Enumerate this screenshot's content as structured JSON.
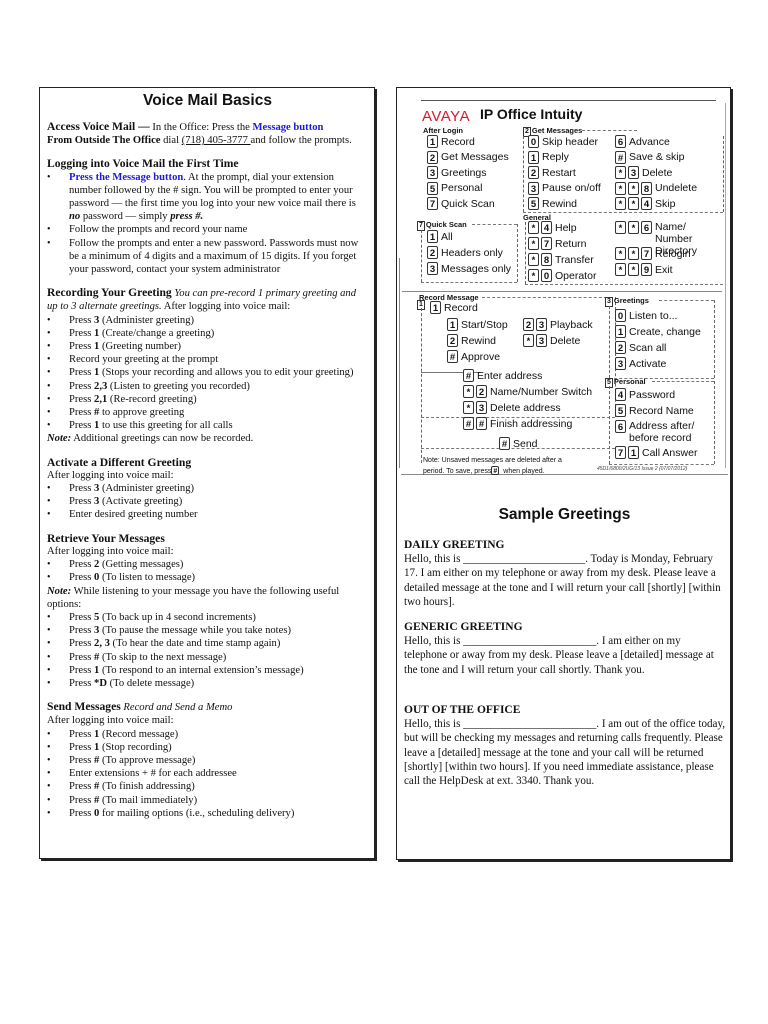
{
  "left": {
    "title": "Voice Mail Basics",
    "access": {
      "heading": "Access Voice Mail —",
      "text1": " In  the Office: Press the ",
      "link": "Message button",
      "outside_label": "From Outside The Office",
      "text2": " dial ",
      "phone": "(718) 405-3777 ",
      "text3": "and follow the prompts."
    },
    "first_time": {
      "heading": "Logging into Voice Mail the First Time",
      "item1_link": "Press the Message button",
      "item1_text": ".  At the prompt, dial your extension number followed by the # sign.  You will be prompted to enter your password — the first time you log into your new voice mail there is ",
      "item1_no": "no",
      "item1_mid": " password — simply ",
      "item1_press": "press #.",
      "items": [
        "Follow the prompts and record your name",
        "Follow the prompts and enter a new password.  Passwords must now be a minimum of 4 digits and a maximum of 15 digits.  If you forget your password, contact your system administrator"
      ]
    },
    "recording": {
      "heading": "Recording Your Greeting",
      "subtitle": " You can pre-record 1 primary greeting and up to 3 alternate greetings.",
      "intro": "  After logging into voice mail:",
      "items": [
        {
          "pre": "Press ",
          "key": "3",
          "post": " (Administer greeting)"
        },
        {
          "pre": "Press ",
          "key": "1",
          "post": " (Create/change a greeting)"
        },
        {
          "pre": "Press ",
          "key": "1",
          "post": " (Greeting number)"
        },
        {
          "pre": "Record your greeting at the prompt",
          "key": "",
          "post": ""
        },
        {
          "pre": "Press ",
          "key": "1",
          "post": " (Stops your recording and allows you to edit your greeting)"
        },
        {
          "pre": "Press ",
          "key": "2,3",
          "post": " (Listen to greeting you recorded)"
        },
        {
          "pre": "Press ",
          "key": "2,1",
          "post": " (Re-record greeting)"
        },
        {
          "pre": "Press ",
          "key": "#",
          "post": " to approve greeting"
        },
        {
          "pre": "Press ",
          "key": "1",
          "post": " to use this greeting for all calls"
        }
      ],
      "note_label": "Note:",
      "note_text": "  Additional greetings can now be recorded."
    },
    "activate": {
      "heading": "Activate a Different Greeting",
      "intro": "After logging into voice mail:",
      "items": [
        {
          "pre": "Press ",
          "key": "3",
          "post": " (Administer greeting)"
        },
        {
          "pre": "Press ",
          "key": "3",
          "post": " (Activate greeting)"
        },
        {
          "pre": "Enter desired greeting number",
          "key": "",
          "post": ""
        }
      ]
    },
    "retrieve": {
      "heading": "Retrieve Your Messages",
      "intro": "After logging into voice mail:",
      "items": [
        {
          "pre": "Press ",
          "key": "2",
          "post": " (Getting messages)"
        },
        {
          "pre": "Press ",
          "key": "0",
          "post": " (To listen to message)"
        }
      ],
      "note_label": "Note:",
      "note_text": "  While listening to your message you have the following useful options:",
      "options": [
        {
          "pre": "Press ",
          "key": "5",
          "post": " (To back up in 4 second increments)"
        },
        {
          "pre": "Press ",
          "key": "3",
          "post": " (To pause the message while you take notes)"
        },
        {
          "pre": "Press ",
          "key": "2, 3",
          "post": " (To hear the date and time stamp again)"
        },
        {
          "pre": "Press ",
          "key": "#",
          "post": " (To skip to the next message)"
        },
        {
          "pre": "Press ",
          "key": "1",
          "post": " (To respond to an internal extension’s message)"
        },
        {
          "pre": "Press ",
          "key": "*D",
          "post": " (To delete message)"
        }
      ]
    },
    "send": {
      "heading": "Send Messages",
      "subtitle": " Record and Send a Memo",
      "intro": "After logging into voice mail:",
      "items": [
        {
          "pre": "Press ",
          "key": "1",
          "post": " (Record message)"
        },
        {
          "pre": "Press ",
          "key": "1",
          "post": " (Stop recording)"
        },
        {
          "pre": "Press ",
          "key": "#",
          "post": " (To approve message)"
        },
        {
          "pre": "Enter extensions + # for each addressee",
          "key": "",
          "post": ""
        },
        {
          "pre": "Press ",
          "key": "#",
          "post": " (To finish addressing)"
        },
        {
          "pre": "Press ",
          "key": "#",
          "post": " (To mail immediately)"
        },
        {
          "pre": "Press ",
          "key": "0",
          "post": " for mailing options (i.e., scheduling delivery)"
        }
      ]
    }
  },
  "card": {
    "brand": "AVAYA",
    "product": "IP Office Intuity",
    "after_login": {
      "label": "After Login",
      "items": [
        {
          "key": "1",
          "label": "Record"
        },
        {
          "key": "2",
          "label": "Get Messages"
        },
        {
          "key": "3",
          "label": "Greetings"
        },
        {
          "key": "5",
          "label": "Personal"
        },
        {
          "key": "7",
          "label": "Quick Scan"
        }
      ]
    },
    "get_messages": {
      "num": "2",
      "label": "Get Messages",
      "col1": [
        {
          "keys": [
            "0"
          ],
          "label": "Skip header"
        },
        {
          "keys": [
            "1"
          ],
          "label": "Reply"
        },
        {
          "keys": [
            "2"
          ],
          "label": "Restart"
        },
        {
          "keys": [
            "3"
          ],
          "label": "Pause on/off"
        },
        {
          "keys": [
            "5"
          ],
          "label": "Rewind"
        }
      ],
      "col2": [
        {
          "keys": [
            "6"
          ],
          "label": "Advance"
        },
        {
          "keys": [
            "#"
          ],
          "label": "Save & skip"
        },
        {
          "keys": [
            "*",
            "3"
          ],
          "label": "Delete"
        },
        {
          "keys": [
            "*",
            "*",
            "8"
          ],
          "label": "Undelete"
        },
        {
          "keys": [
            "*",
            "*",
            "4"
          ],
          "label": "Skip"
        }
      ]
    },
    "quick_scan": {
      "num": "7",
      "label": "Quick Scan",
      "items": [
        {
          "key": "1",
          "label": "All"
        },
        {
          "key": "2",
          "label": "Headers only"
        },
        {
          "key": "3",
          "label": "Messages only"
        }
      ]
    },
    "general": {
      "label": "General",
      "col1": [
        {
          "keys": [
            "*",
            "4"
          ],
          "label": "Help"
        },
        {
          "keys": [
            "*",
            "7"
          ],
          "label": "Return"
        },
        {
          "keys": [
            "*",
            "8"
          ],
          "label": "Transfer"
        },
        {
          "keys": [
            "*",
            "0"
          ],
          "label": "Operator"
        }
      ],
      "col2": [
        {
          "keys": [
            "*",
            "*",
            "6"
          ],
          "label": "Name/ Number Directory"
        },
        {
          "keys": [
            "*",
            "*",
            "7"
          ],
          "label": "Relogin"
        },
        {
          "keys": [
            "*",
            "*",
            "9"
          ],
          "label": "Exit"
        }
      ]
    },
    "record_message": {
      "num": "1",
      "label": "Record Message",
      "record": {
        "key": "1",
        "label": "Record"
      },
      "start_stop": {
        "key": "1",
        "label": "Start/Stop"
      },
      "rewind": {
        "key": "2",
        "label": "Rewind"
      },
      "approve": {
        "key": "#",
        "label": "Approve"
      },
      "playback": {
        "keys": [
          "2",
          "3"
        ],
        "label": "Playback"
      },
      "delete": {
        "keys": [
          "*",
          "3"
        ],
        "label": "Delete"
      },
      "enter_address": {
        "key": "#",
        "label": "Enter address"
      },
      "name_switch": {
        "keys": [
          "*",
          "2"
        ],
        "label": "Name/Number Switch"
      },
      "delete_address": {
        "keys": [
          "*",
          "3"
        ],
        "label": "Delete address"
      },
      "finish": {
        "keys": [
          "#",
          "#"
        ],
        "label": "Finish addressing"
      },
      "send": {
        "key": "#",
        "label": "Send"
      }
    },
    "greetings": {
      "num": "3",
      "label": "Greetings",
      "items": [
        {
          "key": "0",
          "label": "Listen to..."
        },
        {
          "key": "1",
          "label": "Create, change"
        },
        {
          "key": "2",
          "label": "Scan all"
        },
        {
          "key": "3",
          "label": "Activate"
        }
      ]
    },
    "personal": {
      "num": "5",
      "label": "Personal",
      "items": [
        {
          "keys": [
            "4"
          ],
          "label": "Password"
        },
        {
          "keys": [
            "5"
          ],
          "label": "Record Name"
        },
        {
          "keys": [
            "6"
          ],
          "label": "Address after/ before record"
        },
        {
          "keys": [
            "7",
            "1"
          ],
          "label": "Call Answer"
        }
      ]
    },
    "note_line1": "Note: Unsaved messages are deleted after a",
    "note_line2a": "period. To save, press",
    "note_key": "#",
    "note_line2b": " when played.",
    "doc_id": "45D1/6800/2UG/13 Issue 2 (07/07/2012)"
  },
  "greetings": {
    "title": "Sample Greetings",
    "daily": {
      "heading": "DAILY GREETING",
      "text": "Hello, this is ______________________.  Today is Monday, February 17.  I am either on my telephone or away from my desk.  Please leave a detailed message at the tone and I will return your call [shortly] [within two hours]."
    },
    "generic": {
      "heading": "GENERIC GREETING",
      "text": "Hello, this is ________________________.   I am either on my telephone or away from my desk.  Please leave a [detailed] message at the tone and I will return your call shortly.  Thank you."
    },
    "out": {
      "heading": "OUT OF THE OFFICE",
      "text": "Hello, this is ________________________.   I am out of the office today, but will be checking my messages and returning calls frequently.  Please leave a [detailed] message at the tone and your call will be returned [shortly] [within two hours].  If you need immediate assistance, please call the HelpDesk at ext. 3340. Thank you."
    }
  }
}
